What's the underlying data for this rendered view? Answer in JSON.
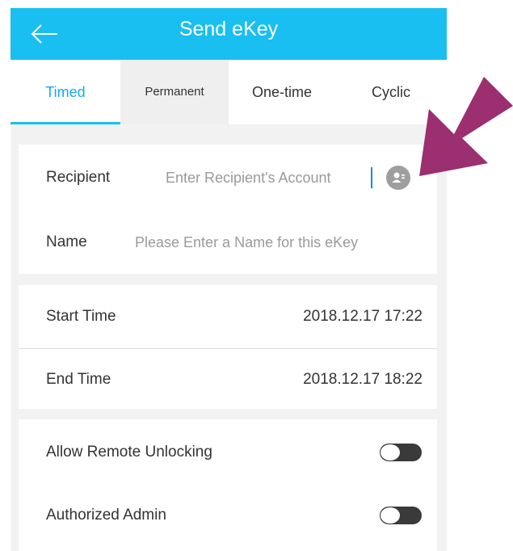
{
  "header": {
    "title": "Send eKey",
    "back_icon": "back-arrow-icon"
  },
  "tabs": [
    {
      "label": "Timed",
      "active": true
    },
    {
      "label": "Permanent",
      "active": false
    },
    {
      "label": "One-time",
      "active": false
    },
    {
      "label": "Cyclic",
      "active": false
    }
  ],
  "recipient": {
    "label": "Recipient",
    "placeholder": "Enter Recipient's Account",
    "contacts_icon": "contacts-icon"
  },
  "name": {
    "label": "Name",
    "placeholder": "Please Enter a Name for this eKey"
  },
  "time": {
    "start_label": "Start Time",
    "start_value": "2018.12.17 17:22",
    "end_label": "End Time",
    "end_value": "2018.12.17 18:22"
  },
  "options": {
    "remote_label": "Allow Remote Unlocking",
    "remote_on": false,
    "admin_label": "Authorized Admin",
    "admin_on": false
  },
  "colors": {
    "accent": "#19bff0",
    "annotation_arrow": "#9b2f6f"
  }
}
